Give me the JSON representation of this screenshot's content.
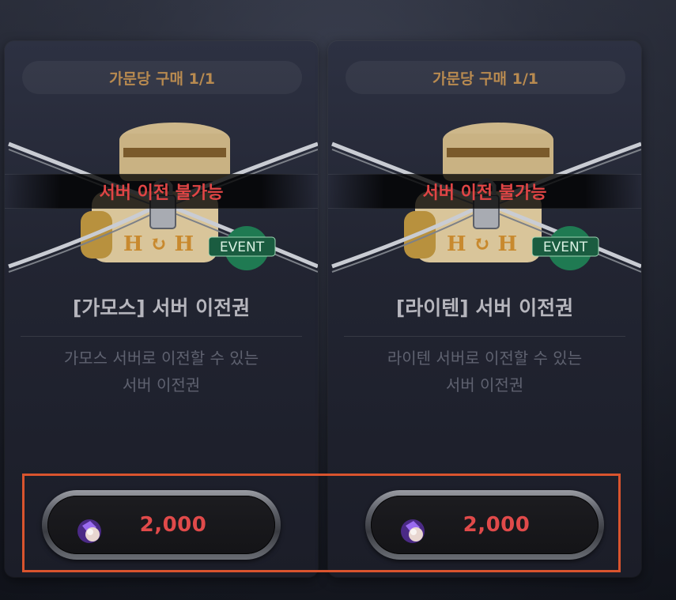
{
  "cards": [
    {
      "limit": "가문당 구매 1/1",
      "banner": "서버 이전 불가능",
      "badge": "EVENT",
      "name": "[가모스] 서버 이전권",
      "desc_line1": "가모스 서버로 이전할 수 있는",
      "desc_line2": "서버 이전권",
      "price": "2,000",
      "currency_icon": "purple-gem-icon"
    },
    {
      "limit": "가문당 구매 1/1",
      "banner": "서버 이전 불가능",
      "badge": "EVENT",
      "name": "[라이텐] 서버 이전권",
      "desc_line1": "라이텐 서버로 이전할 수 있는",
      "desc_line2": "서버 이전권",
      "price": "2,000",
      "currency_icon": "purple-gem-icon"
    }
  ],
  "colors": {
    "limit_text": "#b88a50",
    "banner_text": "#e04545",
    "price_text": "#e04a4a",
    "highlight": "#d9542e"
  }
}
